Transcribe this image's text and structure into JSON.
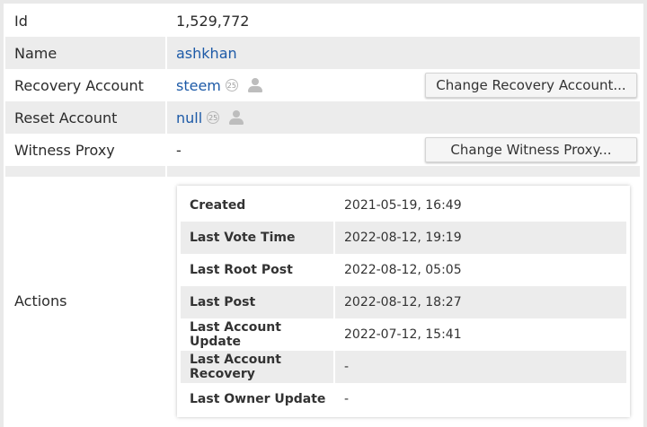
{
  "fields": {
    "id": {
      "label": "Id",
      "value": "1,529,772"
    },
    "name": {
      "label": "Name",
      "value": "ashkhan"
    },
    "recovery_account": {
      "label": "Recovery Account",
      "value": "steem",
      "badge": "25",
      "button": "Change Recovery Account..."
    },
    "reset_account": {
      "label": "Reset Account",
      "value": "null",
      "badge": "25"
    },
    "witness_proxy": {
      "label": "Witness Proxy",
      "value": "-",
      "button": "Change Witness Proxy..."
    },
    "actions": {
      "label": "Actions"
    }
  },
  "actions": [
    {
      "key": "Created",
      "value": "2021-05-19, 16:49"
    },
    {
      "key": "Last Vote Time",
      "value": "2022-08-12, 19:19"
    },
    {
      "key": "Last Root Post",
      "value": "2022-08-12, 05:05"
    },
    {
      "key": "Last Post",
      "value": "2022-08-12, 18:27"
    },
    {
      "key": "Last Account Update",
      "value": "2022-07-12, 15:41"
    },
    {
      "key": "Last Account Recovery",
      "value": "-"
    },
    {
      "key": "Last Owner Update",
      "value": "-"
    }
  ],
  "icons": {
    "user": "person-icon"
  },
  "colors": {
    "link": "#1d5aa7",
    "shade": "#ececec"
  }
}
